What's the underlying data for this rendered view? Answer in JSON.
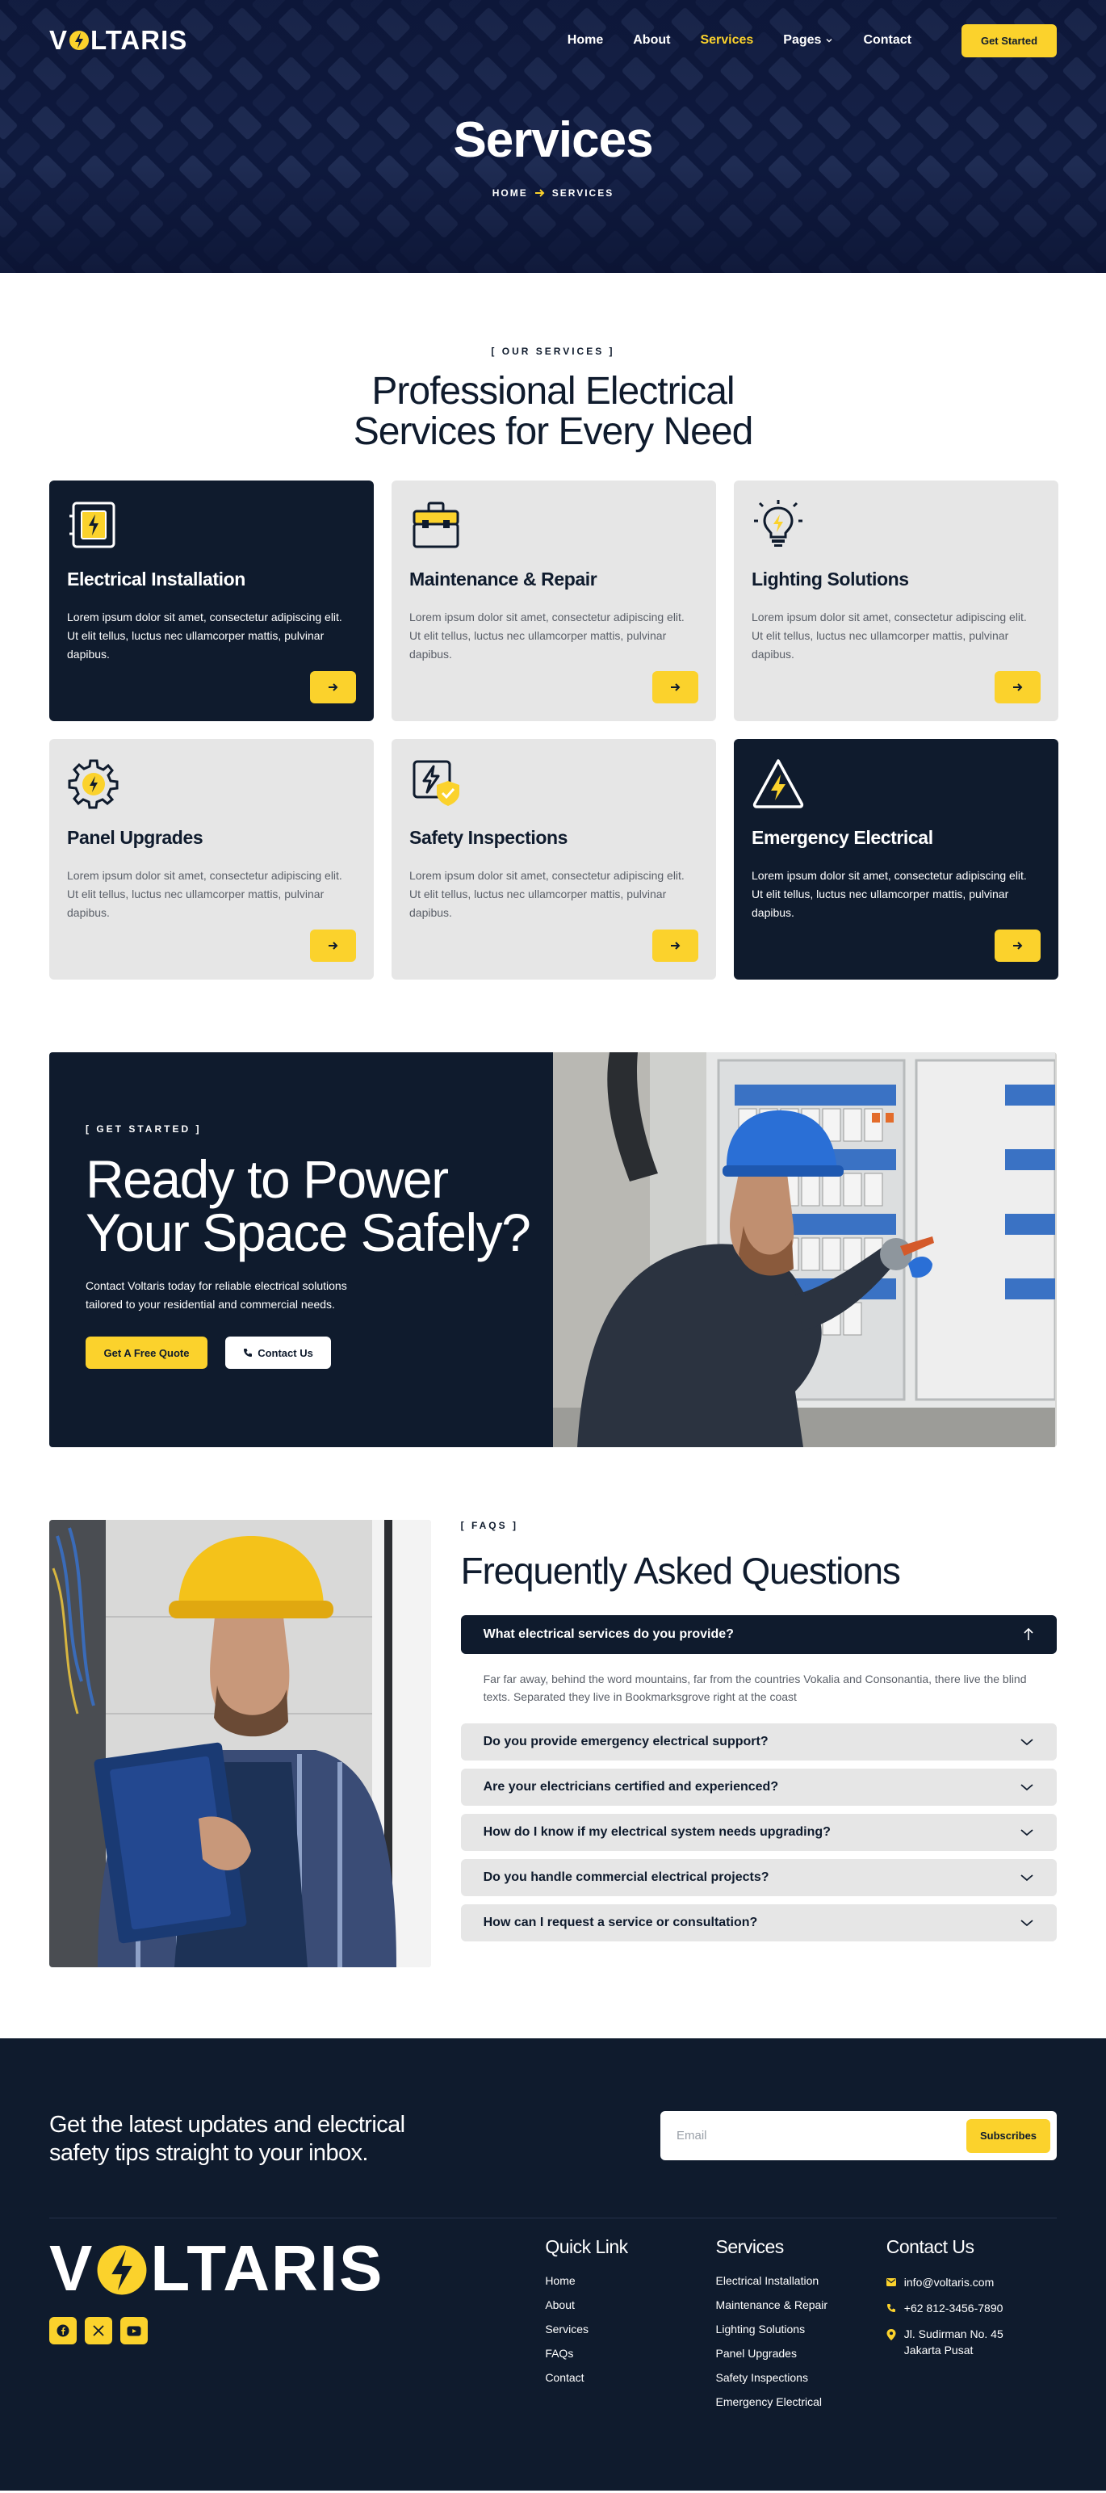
{
  "brand": {
    "name": "VOLTARIS",
    "name_pre": "V",
    "name_post": "LTARIS",
    "accent": "#fbd22c",
    "dark": "#0f1b2d"
  },
  "nav": {
    "items": [
      {
        "label": "Home",
        "active": false
      },
      {
        "label": "About",
        "active": false
      },
      {
        "label": "Services",
        "active": true
      },
      {
        "label": "Pages",
        "active": false,
        "dropdown": true
      },
      {
        "label": "Contact",
        "active": false
      }
    ],
    "cta_label": "Get Started"
  },
  "hero": {
    "title": "Services",
    "breadcrumb_home": "HOME",
    "breadcrumb_current": "SERVICES"
  },
  "services": {
    "eyebrow": "[ OUR SERVICES ]",
    "title_line1": "Professional Electrical",
    "title_line2": "Services for Every Need",
    "cards": [
      {
        "title": "Electrical Installation",
        "desc": "Lorem ipsum dolor sit amet, consectetur adipiscing elit. Ut elit tellus, luctus nec ullamcorper mattis, pulvinar dapibus.",
        "icon": "electrical-panel-icon",
        "dark": true
      },
      {
        "title": "Maintenance & Repair",
        "desc": "Lorem ipsum dolor sit amet, consectetur adipiscing elit. Ut elit tellus, luctus nec ullamcorper mattis, pulvinar dapibus.",
        "icon": "toolbox-icon",
        "dark": false
      },
      {
        "title": "Lighting Solutions",
        "desc": "Lorem ipsum dolor sit amet, consectetur adipiscing elit. Ut elit tellus, luctus nec ullamcorper mattis, pulvinar dapibus.",
        "icon": "lightbulb-icon",
        "dark": false
      },
      {
        "title": "Panel Upgrades",
        "desc": "Lorem ipsum dolor sit amet, consectetur adipiscing elit. Ut elit tellus, luctus nec ullamcorper mattis, pulvinar dapibus.",
        "icon": "gear-bolt-icon",
        "dark": false
      },
      {
        "title": "Safety Inspections",
        "desc": "Lorem ipsum dolor sit amet, consectetur adipiscing elit. Ut elit tellus, luctus nec ullamcorper mattis, pulvinar dapibus.",
        "icon": "shield-check-icon",
        "dark": false
      },
      {
        "title": "Emergency Electrical",
        "desc": "Lorem ipsum dolor sit amet, consectetur adipiscing elit. Ut elit tellus, luctus nec ullamcorper mattis, pulvinar dapibus.",
        "icon": "warning-bolt-icon",
        "dark": true
      }
    ]
  },
  "cta": {
    "eyebrow": "[ GET STARTED ]",
    "title_line1": "Ready to Power",
    "title_line2": "Your Space Safely?",
    "text": "Contact Voltaris today for reliable electrical solutions tailored to your residential and commercial needs.",
    "primary_label": "Get A Free Quote",
    "secondary_label": "Contact Us"
  },
  "faq": {
    "eyebrow": "[ FAQS ]",
    "title": "Frequently Asked Questions",
    "open_question": "What electrical services do you provide?",
    "open_answer": "Far far away, behind the word mountains, far from the countries Vokalia and Consonantia, there live the blind texts. Separated they live in Bookmarksgrove right at the coast",
    "items": [
      "Do you provide emergency electrical support?",
      "Are your electricians certified and experienced?",
      "How do I know if my electrical system needs upgrading?",
      "Do you handle commercial electrical projects?",
      "How can I request a service or consultation?"
    ]
  },
  "footer": {
    "newsletter_text": "Get the latest updates and electrical safety tips straight to your inbox.",
    "email_placeholder": "Email",
    "subscribe_label": "Subscribes",
    "quick_link_title": "Quick Link",
    "quick_links": [
      "Home",
      "About",
      "Services",
      "FAQs",
      "Contact"
    ],
    "services_title": "Services",
    "services_links": [
      "Electrical Installation",
      "Maintenance & Repair",
      "Lighting Solutions",
      "Panel Upgrades",
      "Safety Inspections",
      "Emergency Electrical"
    ],
    "contact_title": "Contact Us",
    "contact": {
      "email": "info@voltaris.com",
      "phone": "+62 812-3456-7890",
      "address": "Jl. Sudirman No. 45 Jakarta Pusat"
    },
    "socials": [
      "facebook-icon",
      "x-icon",
      "youtube-icon"
    ]
  }
}
